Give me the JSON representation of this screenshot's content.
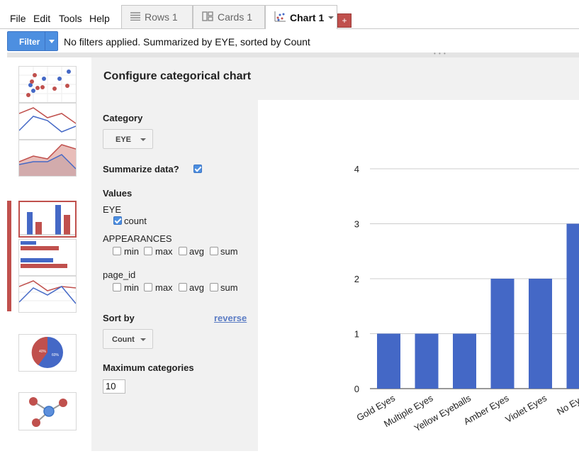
{
  "menu": [
    "File",
    "Edit",
    "Tools",
    "Help"
  ],
  "tabs": [
    {
      "label": "Rows 1",
      "icon": "rows-icon"
    },
    {
      "label": "Cards 1",
      "icon": "cards-icon"
    },
    {
      "label": "Chart 1",
      "icon": "scatter-chart-icon"
    }
  ],
  "add_tab_label": "+",
  "filter": {
    "button_label": "Filter",
    "status": "No filters applied. Summarized by EYE, sorted by Count"
  },
  "config_title": "Configure categorical chart",
  "category": {
    "label": "Category",
    "value": "EYE"
  },
  "summarize": {
    "label": "Summarize data?",
    "checked": true
  },
  "values": {
    "label": "Values",
    "fields": [
      {
        "name": "EYE",
        "options": [
          {
            "label": "count",
            "checked": true
          }
        ]
      },
      {
        "name": "APPEARANCES",
        "options": [
          {
            "label": "min",
            "checked": false
          },
          {
            "label": "max",
            "checked": false
          },
          {
            "label": "avg",
            "checked": false
          },
          {
            "label": "sum",
            "checked": false
          }
        ]
      },
      {
        "name": "page_id",
        "options": [
          {
            "label": "min",
            "checked": false
          },
          {
            "label": "max",
            "checked": false
          },
          {
            "label": "avg",
            "checked": false
          },
          {
            "label": "sum",
            "checked": false
          }
        ]
      }
    ]
  },
  "sort": {
    "label": "Sort by",
    "value": "Count",
    "reverse_label": "reverse"
  },
  "max_categories": {
    "label": "Maximum categories",
    "value": "10"
  },
  "colors": {
    "bar": "#4468c6",
    "accent_red": "#c0504d",
    "filter_blue": "#4d8fe0"
  },
  "chart_data": {
    "type": "bar",
    "categories": [
      "Gold Eyes",
      "Multiple Eyes",
      "Yellow Eyeballs",
      "Amber Eyes",
      "Violet Eyes",
      "No Eye"
    ],
    "values": [
      1,
      1,
      1,
      2,
      2,
      3
    ],
    "yticks": [
      "0",
      "1",
      "2",
      "3",
      "4"
    ],
    "ylim": [
      0,
      4
    ],
    "grid": true
  }
}
